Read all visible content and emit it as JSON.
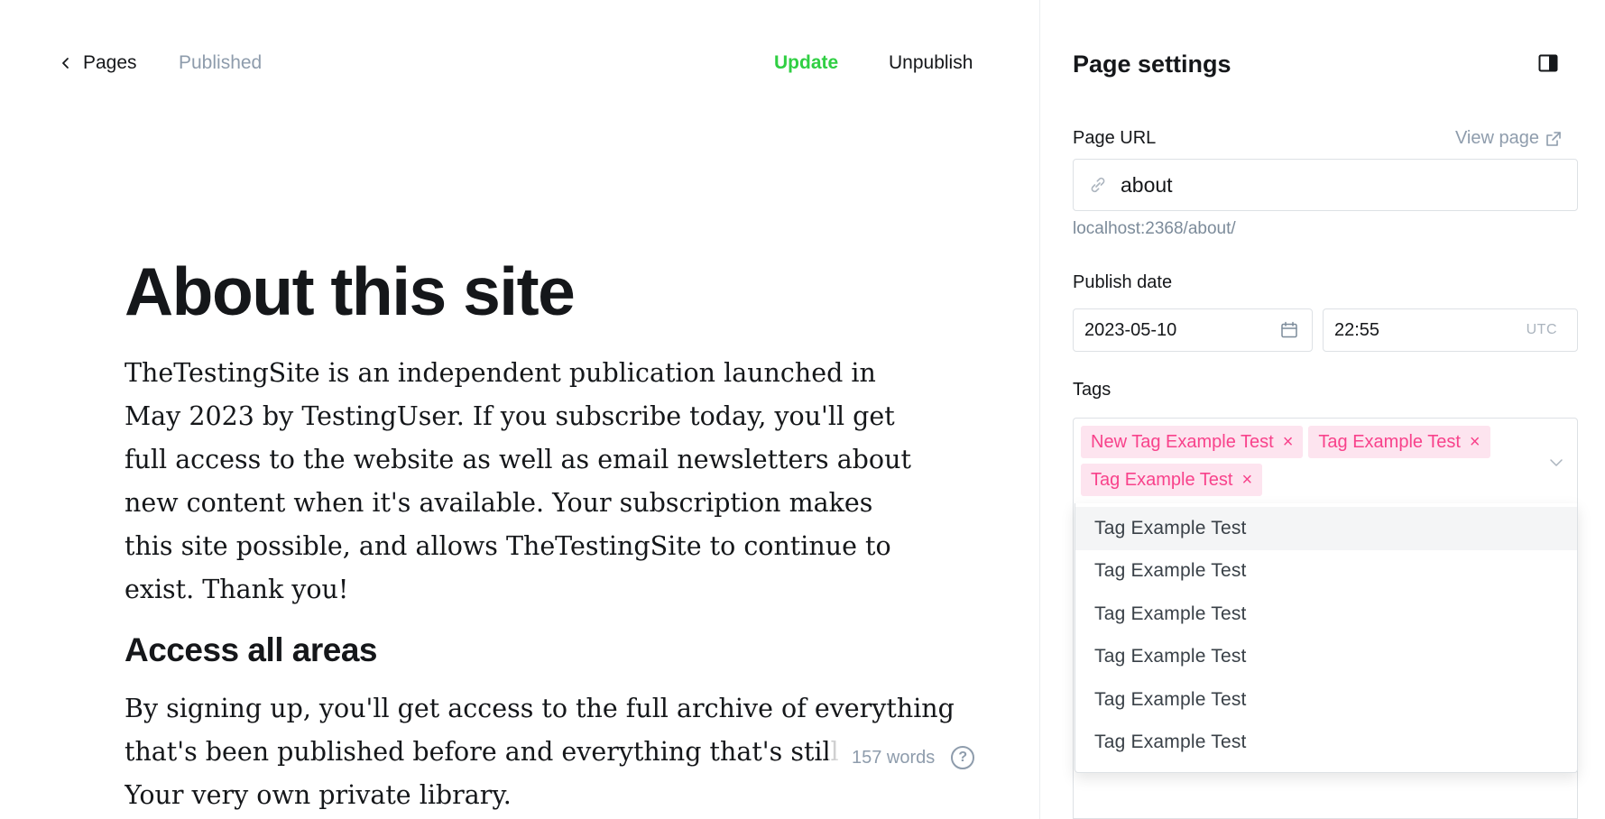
{
  "topbar": {
    "back_label": "Pages",
    "status": "Published",
    "update_label": "Update",
    "unpublish_label": "Unpublish"
  },
  "post": {
    "title": "About this site",
    "paragraph1": "TheTestingSite is an independent publication launched in May 2023 by TestingUser. If you subscribe today, you'll get full access to the website as well as email newsletters about new content when it's available. Your subscription makes this site possible, and allows TheTestingSite to continue to exist. Thank you!",
    "heading2": "Access all areas",
    "paragraph2": "By signing up, you'll get access to the full archive of everything that's been published before and everything that's still to come. Your very own private library.",
    "word_count": "157 words",
    "help_glyph": "?"
  },
  "settings": {
    "title": "Page settings",
    "page_url_label": "Page URL",
    "view_page_label": "View page",
    "url_value": "about",
    "url_hint": "localhost:2368/about/",
    "publish_date_label": "Publish date",
    "date_value": "2023-05-10",
    "time_value": "22:55",
    "timezone": "UTC",
    "tags_label": "Tags",
    "selected_tags": [
      "New Tag Example Test",
      "Tag Example Test",
      "Tag Example Test"
    ],
    "tag_options": [
      "Tag Example Test",
      "Tag Example Test",
      "Tag Example Test",
      "Tag Example Test",
      "Tag Example Test",
      "Tag Example Test"
    ],
    "remove_glyph": "×"
  },
  "colors": {
    "accent_green": "#30cf43",
    "tag_pink": "#f8428b",
    "tag_pink_bg": "#fde4ef",
    "muted": "#8e9cac"
  },
  "icons": {
    "back": "chevron-left-icon",
    "panel": "sidebar-panel-icon",
    "external": "external-link-icon",
    "link": "link-icon",
    "calendar": "calendar-icon",
    "chevron": "chevron-down-icon"
  }
}
